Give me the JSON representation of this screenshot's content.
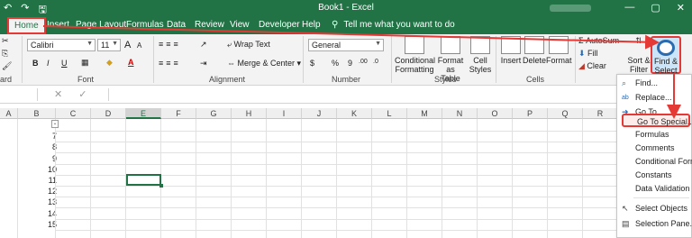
{
  "titlebar": {
    "doc_title": "Book1  -  Excel",
    "qat": [
      "↶",
      "↷",
      "🖫"
    ],
    "controls": [
      "—",
      "▢",
      "✕"
    ]
  },
  "tabs": [
    "Home",
    "Insert",
    "Page Layout",
    "Formulas",
    "Data",
    "Review",
    "View",
    "Developer",
    "Help"
  ],
  "tell_me": "Tell me what you want to do",
  "ribbon": {
    "font_name": "Calibri",
    "font_size": "11",
    "number_format": "General",
    "wrap_text": "Wrap Text",
    "merge_center": "Merge & Center",
    "bold": "B",
    "italic": "I",
    "underline": "U",
    "font_grow": "A",
    "font_shrink": "A",
    "currency": "$",
    "percent": "%",
    "comma": "9",
    "dec_inc": ".00",
    "dec_dec": ".0",
    "conditional_formatting": [
      "Conditional",
      "Formatting"
    ],
    "format_as_table": [
      "Format as",
      "Table"
    ],
    "cell_styles": [
      "Cell",
      "Styles"
    ],
    "insert": "Insert",
    "delete": "Delete",
    "format": "Format",
    "autosum": "AutoSum",
    "fill": "Fill",
    "clear": "Clear",
    "sort_filter": [
      "Sort &",
      "Filter"
    ],
    "find_select": [
      "Find &",
      "Select"
    ],
    "groups": {
      "clipboard": "ard",
      "font": "Font",
      "alignment": "Alignment",
      "number": "Number",
      "styles": "Styles",
      "cells": "Cells"
    }
  },
  "formula_bar": {
    "icons": [
      "✕",
      "✓"
    ]
  },
  "grid": {
    "columns": [
      "A",
      "B",
      "C",
      "D",
      "E",
      "F",
      "G",
      "H",
      "I",
      "J",
      "K",
      "L",
      "M",
      "N",
      "O",
      "P",
      "Q",
      "R"
    ],
    "selected_column": "E",
    "rows": [
      "",
      "7",
      "8",
      "9",
      "10",
      "11",
      "12",
      "13",
      "14",
      "15"
    ]
  },
  "find_menu": {
    "items": [
      {
        "label": "Find...",
        "icon": "⌕"
      },
      {
        "label": "Replace...",
        "icon": "ab"
      },
      {
        "label": "Go To...",
        "icon": "➜"
      },
      {
        "label": "Go To Special...",
        "icon": ""
      },
      {
        "label": "Formulas",
        "icon": ""
      },
      {
        "label": "Comments",
        "icon": ""
      },
      {
        "label": "Conditional Formatt",
        "icon": ""
      },
      {
        "label": "Constants",
        "icon": ""
      },
      {
        "label": "Data Validation",
        "icon": ""
      },
      {
        "label": "Select Objects",
        "icon": "↖"
      },
      {
        "label": "Selection Pane...",
        "icon": "▤"
      }
    ]
  },
  "colors": {
    "excel_green": "#217346",
    "annotation_red": "#e53935",
    "highlight_blue": "#cce4f7"
  }
}
